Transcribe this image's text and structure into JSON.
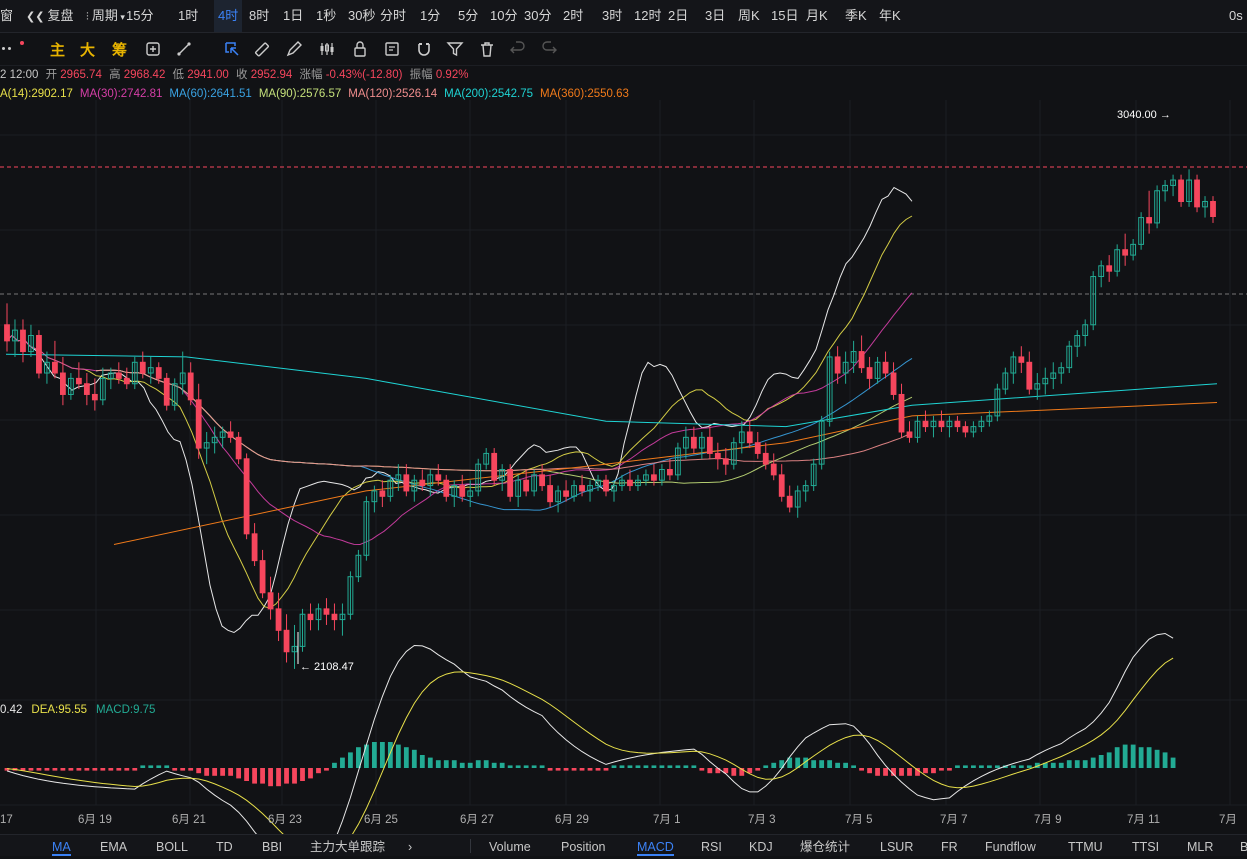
{
  "topbar": {
    "items": [
      {
        "label": "窗",
        "active": false
      },
      {
        "label": "复盘",
        "active": false
      },
      {
        "label": "周期",
        "active": false
      },
      {
        "label": "15分",
        "active": false
      },
      {
        "label": "1时",
        "active": false
      },
      {
        "label": "4时",
        "active": true
      },
      {
        "label": "8时",
        "active": false
      },
      {
        "label": "1日",
        "active": false
      },
      {
        "label": "1秒",
        "active": false
      },
      {
        "label": "30秒",
        "active": false
      },
      {
        "label": "分时",
        "active": false
      },
      {
        "label": "1分",
        "active": false
      },
      {
        "label": "5分",
        "active": false
      },
      {
        "label": "10分",
        "active": false
      },
      {
        "label": "30分",
        "active": false
      },
      {
        "label": "2时",
        "active": false
      },
      {
        "label": "3时",
        "active": false
      },
      {
        "label": "12时",
        "active": false
      },
      {
        "label": "2日",
        "active": false
      },
      {
        "label": "3日",
        "active": false
      },
      {
        "label": "周K",
        "active": false
      },
      {
        "label": "15日",
        "active": false
      },
      {
        "label": "月K",
        "active": false
      },
      {
        "label": "季K",
        "active": false
      },
      {
        "label": "年K",
        "active": false
      }
    ],
    "right_label": "0s"
  },
  "toolbar": {
    "text_tools": [
      "主",
      "大",
      "筹"
    ],
    "icons": [
      "circle-swap-icon",
      "line-tool-icon",
      "cursor-select-icon",
      "ruler-icon",
      "pen-icon",
      "candles-icon",
      "lock-icon",
      "note-icon",
      "magnet-icon",
      "filter-icon",
      "trash-icon",
      "undo-icon",
      "redo-icon"
    ]
  },
  "ohlc": {
    "time": "2 12:00",
    "open_label": "开",
    "open": "2965.74",
    "high_label": "高",
    "high": "2968.42",
    "low_label": "低",
    "low": "2941.00",
    "close_label": "收",
    "close": "2952.94",
    "change_label": "涨幅",
    "change": "-0.43%(-12.80)",
    "amp_label": "振幅",
    "amp": "0.92%"
  },
  "ma_legend": [
    {
      "label": "A(14):2902.17",
      "color": "#e8e04a"
    },
    {
      "label": "MA(30):2742.81",
      "color": "#d63fa8"
    },
    {
      "label": "MA(60):2641.51",
      "color": "#3aa3e3"
    },
    {
      "label": "MA(90):2576.57",
      "color": "#c4e07a"
    },
    {
      "label": "MA(120):2526.14",
      "color": "#f08d8d"
    },
    {
      "label": "MA(200):2542.75",
      "color": "#1fd3d3"
    },
    {
      "label": "MA(360):2550.63",
      "color": "#f07a1a"
    }
  ],
  "macd_legend": [
    {
      "label": "0.42",
      "color": "#e8e8e8"
    },
    {
      "label": "DEA:95.55",
      "color": "#e8e04a"
    },
    {
      "label": "MACD:9.75",
      "color": "#22ab94"
    }
  ],
  "bottombar": {
    "left": [
      {
        "label": "MA",
        "active": true
      },
      {
        "label": "EMA",
        "active": false
      },
      {
        "label": "BOLL",
        "active": false
      },
      {
        "label": "TD",
        "active": false
      },
      {
        "label": "BBI",
        "active": false
      },
      {
        "label": "主力大单跟踪",
        "active": false
      },
      {
        "label": "›",
        "active": false
      }
    ],
    "right": [
      {
        "label": "Volume",
        "active": false
      },
      {
        "label": "Position",
        "active": false
      },
      {
        "label": "MACD",
        "active": true
      },
      {
        "label": "RSI",
        "active": false
      },
      {
        "label": "KDJ",
        "active": false
      },
      {
        "label": "爆仓统计",
        "active": false
      },
      {
        "label": "LSUR",
        "active": false
      },
      {
        "label": "FR",
        "active": false
      },
      {
        "label": "Fundflow",
        "active": false
      },
      {
        "label": "TTMU",
        "active": false
      },
      {
        "label": "TTSI",
        "active": false
      },
      {
        "label": "MLR",
        "active": false
      },
      {
        "label": "B",
        "active": false
      }
    ]
  },
  "chart_data": {
    "type": "candlestick",
    "timeframe": "4时",
    "x_tick_labels": [
      "17",
      "6月 19",
      "6月 21",
      "6月 23",
      "6月 25",
      "6月 27",
      "6月 29",
      "7月 1",
      "7月 3",
      "7月 5",
      "7月 7",
      "7月 9",
      "7月 11",
      "7月"
    ],
    "price_range": [
      2050,
      3160
    ],
    "annotations": {
      "high": "3040.00",
      "low": "2108.47"
    },
    "candles": [
      [
        2750,
        2790,
        2700,
        2720
      ],
      [
        2720,
        2760,
        2690,
        2740
      ],
      [
        2740,
        2760,
        2680,
        2700
      ],
      [
        2700,
        2750,
        2690,
        2730
      ],
      [
        2730,
        2740,
        2650,
        2660
      ],
      [
        2660,
        2700,
        2640,
        2680
      ],
      [
        2680,
        2720,
        2650,
        2660
      ],
      [
        2660,
        2690,
        2600,
        2620
      ],
      [
        2620,
        2660,
        2610,
        2650
      ],
      [
        2650,
        2680,
        2630,
        2640
      ],
      [
        2640,
        2660,
        2600,
        2620
      ],
      [
        2620,
        2650,
        2590,
        2610
      ],
      [
        2610,
        2670,
        2600,
        2650
      ],
      [
        2650,
        2670,
        2630,
        2660
      ],
      [
        2660,
        2680,
        2640,
        2650
      ],
      [
        2650,
        2670,
        2630,
        2640
      ],
      [
        2640,
        2690,
        2630,
        2680
      ],
      [
        2680,
        2700,
        2650,
        2660
      ],
      [
        2660,
        2690,
        2640,
        2670
      ],
      [
        2670,
        2680,
        2640,
        2650
      ],
      [
        2650,
        2660,
        2590,
        2600
      ],
      [
        2600,
        2650,
        2590,
        2640
      ],
      [
        2640,
        2700,
        2620,
        2660
      ],
      [
        2660,
        2680,
        2600,
        2610
      ],
      [
        2610,
        2640,
        2500,
        2520
      ],
      [
        2520,
        2550,
        2490,
        2530
      ],
      [
        2530,
        2560,
        2510,
        2540
      ],
      [
        2540,
        2560,
        2520,
        2550
      ],
      [
        2550,
        2570,
        2530,
        2540
      ],
      [
        2540,
        2550,
        2490,
        2500
      ],
      [
        2500,
        2510,
        2350,
        2360
      ],
      [
        2360,
        2380,
        2300,
        2310
      ],
      [
        2310,
        2330,
        2240,
        2250
      ],
      [
        2250,
        2280,
        2200,
        2220
      ],
      [
        2220,
        2250,
        2160,
        2180
      ],
      [
        2180,
        2210,
        2120,
        2140
      ],
      [
        2140,
        2190,
        2108,
        2150
      ],
      [
        2150,
        2220,
        2140,
        2210
      ],
      [
        2210,
        2230,
        2180,
        2200
      ],
      [
        2200,
        2230,
        2180,
        2220
      ],
      [
        2220,
        2240,
        2190,
        2210
      ],
      [
        2210,
        2230,
        2180,
        2200
      ],
      [
        2200,
        2230,
        2170,
        2210
      ],
      [
        2210,
        2290,
        2200,
        2280
      ],
      [
        2280,
        2330,
        2270,
        2320
      ],
      [
        2320,
        2430,
        2310,
        2420
      ],
      [
        2420,
        2450,
        2400,
        2440
      ],
      [
        2440,
        2460,
        2410,
        2430
      ],
      [
        2430,
        2470,
        2420,
        2460
      ],
      [
        2460,
        2490,
        2440,
        2470
      ],
      [
        2470,
        2490,
        2430,
        2440
      ],
      [
        2440,
        2470,
        2420,
        2460
      ],
      [
        2460,
        2480,
        2440,
        2450
      ],
      [
        2450,
        2480,
        2430,
        2470
      ],
      [
        2470,
        2490,
        2450,
        2460
      ],
      [
        2460,
        2470,
        2420,
        2430
      ],
      [
        2430,
        2460,
        2410,
        2450
      ],
      [
        2450,
        2470,
        2420,
        2430
      ],
      [
        2430,
        2460,
        2410,
        2440
      ],
      [
        2440,
        2500,
        2430,
        2490
      ],
      [
        2490,
        2520,
        2480,
        2510
      ],
      [
        2510,
        2520,
        2450,
        2460
      ],
      [
        2460,
        2490,
        2440,
        2480
      ],
      [
        2480,
        2490,
        2420,
        2430
      ],
      [
        2430,
        2470,
        2410,
        2460
      ],
      [
        2460,
        2480,
        2430,
        2440
      ],
      [
        2440,
        2480,
        2430,
        2470
      ],
      [
        2470,
        2490,
        2440,
        2450
      ],
      [
        2450,
        2470,
        2410,
        2420
      ],
      [
        2420,
        2450,
        2400,
        2440
      ],
      [
        2440,
        2460,
        2420,
        2430
      ],
      [
        2430,
        2460,
        2420,
        2450
      ],
      [
        2450,
        2470,
        2430,
        2440
      ],
      [
        2440,
        2460,
        2420,
        2450
      ],
      [
        2450,
        2470,
        2440,
        2460
      ],
      [
        2460,
        2470,
        2430,
        2440
      ],
      [
        2440,
        2460,
        2420,
        2450
      ],
      [
        2450,
        2470,
        2440,
        2460
      ],
      [
        2460,
        2480,
        2440,
        2450
      ],
      [
        2450,
        2470,
        2440,
        2460
      ],
      [
        2460,
        2480,
        2450,
        2470
      ],
      [
        2470,
        2490,
        2450,
        2460
      ],
      [
        2460,
        2490,
        2450,
        2480
      ],
      [
        2480,
        2500,
        2460,
        2470
      ],
      [
        2470,
        2530,
        2460,
        2520
      ],
      [
        2520,
        2560,
        2500,
        2540
      ],
      [
        2540,
        2560,
        2510,
        2520
      ],
      [
        2520,
        2550,
        2500,
        2540
      ],
      [
        2540,
        2560,
        2500,
        2510
      ],
      [
        2510,
        2530,
        2480,
        2500
      ],
      [
        2500,
        2520,
        2470,
        2490
      ],
      [
        2490,
        2540,
        2480,
        2530
      ],
      [
        2530,
        2570,
        2510,
        2550
      ],
      [
        2550,
        2570,
        2520,
        2530
      ],
      [
        2530,
        2550,
        2500,
        2510
      ],
      [
        2510,
        2530,
        2480,
        2490
      ],
      [
        2490,
        2510,
        2460,
        2470
      ],
      [
        2470,
        2490,
        2420,
        2430
      ],
      [
        2430,
        2450,
        2400,
        2410
      ],
      [
        2410,
        2450,
        2390,
        2440
      ],
      [
        2440,
        2460,
        2420,
        2450
      ],
      [
        2450,
        2500,
        2440,
        2490
      ],
      [
        2490,
        2580,
        2480,
        2570
      ],
      [
        2570,
        2700,
        2560,
        2690
      ],
      [
        2690,
        2710,
        2640,
        2660
      ],
      [
        2660,
        2700,
        2640,
        2680
      ],
      [
        2680,
        2720,
        2660,
        2700
      ],
      [
        2700,
        2730,
        2660,
        2670
      ],
      [
        2670,
        2690,
        2630,
        2650
      ],
      [
        2650,
        2690,
        2640,
        2680
      ],
      [
        2680,
        2700,
        2650,
        2660
      ],
      [
        2660,
        2680,
        2610,
        2620
      ],
      [
        2620,
        2640,
        2540,
        2550
      ],
      [
        2550,
        2570,
        2530,
        2540
      ],
      [
        2540,
        2580,
        2530,
        2570
      ],
      [
        2570,
        2590,
        2550,
        2560
      ],
      [
        2560,
        2580,
        2540,
        2570
      ],
      [
        2570,
        2590,
        2550,
        2560
      ],
      [
        2560,
        2580,
        2540,
        2570
      ],
      [
        2570,
        2580,
        2550,
        2560
      ],
      [
        2560,
        2570,
        2540,
        2550
      ],
      [
        2550,
        2570,
        2540,
        2560
      ],
      [
        2560,
        2580,
        2550,
        2570
      ],
      [
        2570,
        2590,
        2560,
        2580
      ],
      [
        2580,
        2640,
        2570,
        2630
      ],
      [
        2630,
        2670,
        2620,
        2660
      ],
      [
        2660,
        2700,
        2640,
        2690
      ],
      [
        2690,
        2710,
        2660,
        2680
      ],
      [
        2680,
        2700,
        2620,
        2630
      ],
      [
        2630,
        2660,
        2610,
        2640
      ],
      [
        2640,
        2670,
        2620,
        2650
      ],
      [
        2650,
        2680,
        2630,
        2660
      ],
      [
        2660,
        2680,
        2640,
        2670
      ],
      [
        2670,
        2720,
        2660,
        2710
      ],
      [
        2710,
        2740,
        2690,
        2730
      ],
      [
        2730,
        2760,
        2710,
        2750
      ],
      [
        2750,
        2850,
        2740,
        2840
      ],
      [
        2840,
        2870,
        2820,
        2860
      ],
      [
        2860,
        2880,
        2830,
        2850
      ],
      [
        2850,
        2900,
        2840,
        2890
      ],
      [
        2890,
        2920,
        2860,
        2880
      ],
      [
        2880,
        2910,
        2870,
        2900
      ],
      [
        2900,
        2960,
        2890,
        2950
      ],
      [
        2950,
        3000,
        2920,
        2940
      ],
      [
        2940,
        3010,
        2930,
        3000
      ],
      [
        3000,
        3020,
        2980,
        3010
      ],
      [
        3010,
        3030,
        2990,
        3020
      ],
      [
        3020,
        3030,
        2970,
        2980
      ],
      [
        2980,
        3040,
        2970,
        3020
      ],
      [
        3020,
        3030,
        2960,
        2970
      ],
      [
        2970,
        2990,
        2950,
        2980
      ],
      [
        2980,
        2990,
        2940,
        2952
      ]
    ],
    "macd_hist": [
      -1,
      -1,
      -1,
      -1,
      -1,
      -1,
      -1,
      -1,
      -1,
      -1,
      -1,
      -1,
      -1,
      -1,
      -1,
      -1,
      -1,
      1,
      1,
      1,
      1,
      -1,
      -1,
      -1,
      -2,
      -3,
      -3,
      -3,
      -3,
      -4,
      -5,
      -6,
      -6,
      -7,
      -7,
      -6,
      -6,
      -5,
      -4,
      -2,
      -1,
      2,
      4,
      6,
      8,
      9,
      10,
      10,
      10,
      9,
      8,
      7,
      5,
      4,
      3,
      3,
      3,
      2,
      2,
      3,
      3,
      2,
      2,
      1,
      1,
      1,
      1,
      1,
      -1,
      -1,
      -1,
      -1,
      -1,
      -1,
      -1,
      -1,
      1,
      1,
      1,
      1,
      1,
      1,
      1,
      1,
      1,
      1,
      1,
      -1,
      -2,
      -2,
      -2,
      -3,
      -3,
      -2,
      -1,
      1,
      2,
      3,
      4,
      4,
      4,
      3,
      3,
      3,
      2,
      2,
      1,
      -1,
      -2,
      -3,
      -3,
      -3,
      -3,
      -3,
      -3,
      -2,
      -2,
      -1,
      -1,
      1,
      1,
      1,
      1,
      1,
      1,
      1,
      1,
      1,
      1,
      2,
      2,
      2,
      2,
      3,
      3,
      3,
      4,
      5,
      6,
      8,
      9,
      9,
      8,
      8,
      7,
      6,
      4
    ]
  }
}
